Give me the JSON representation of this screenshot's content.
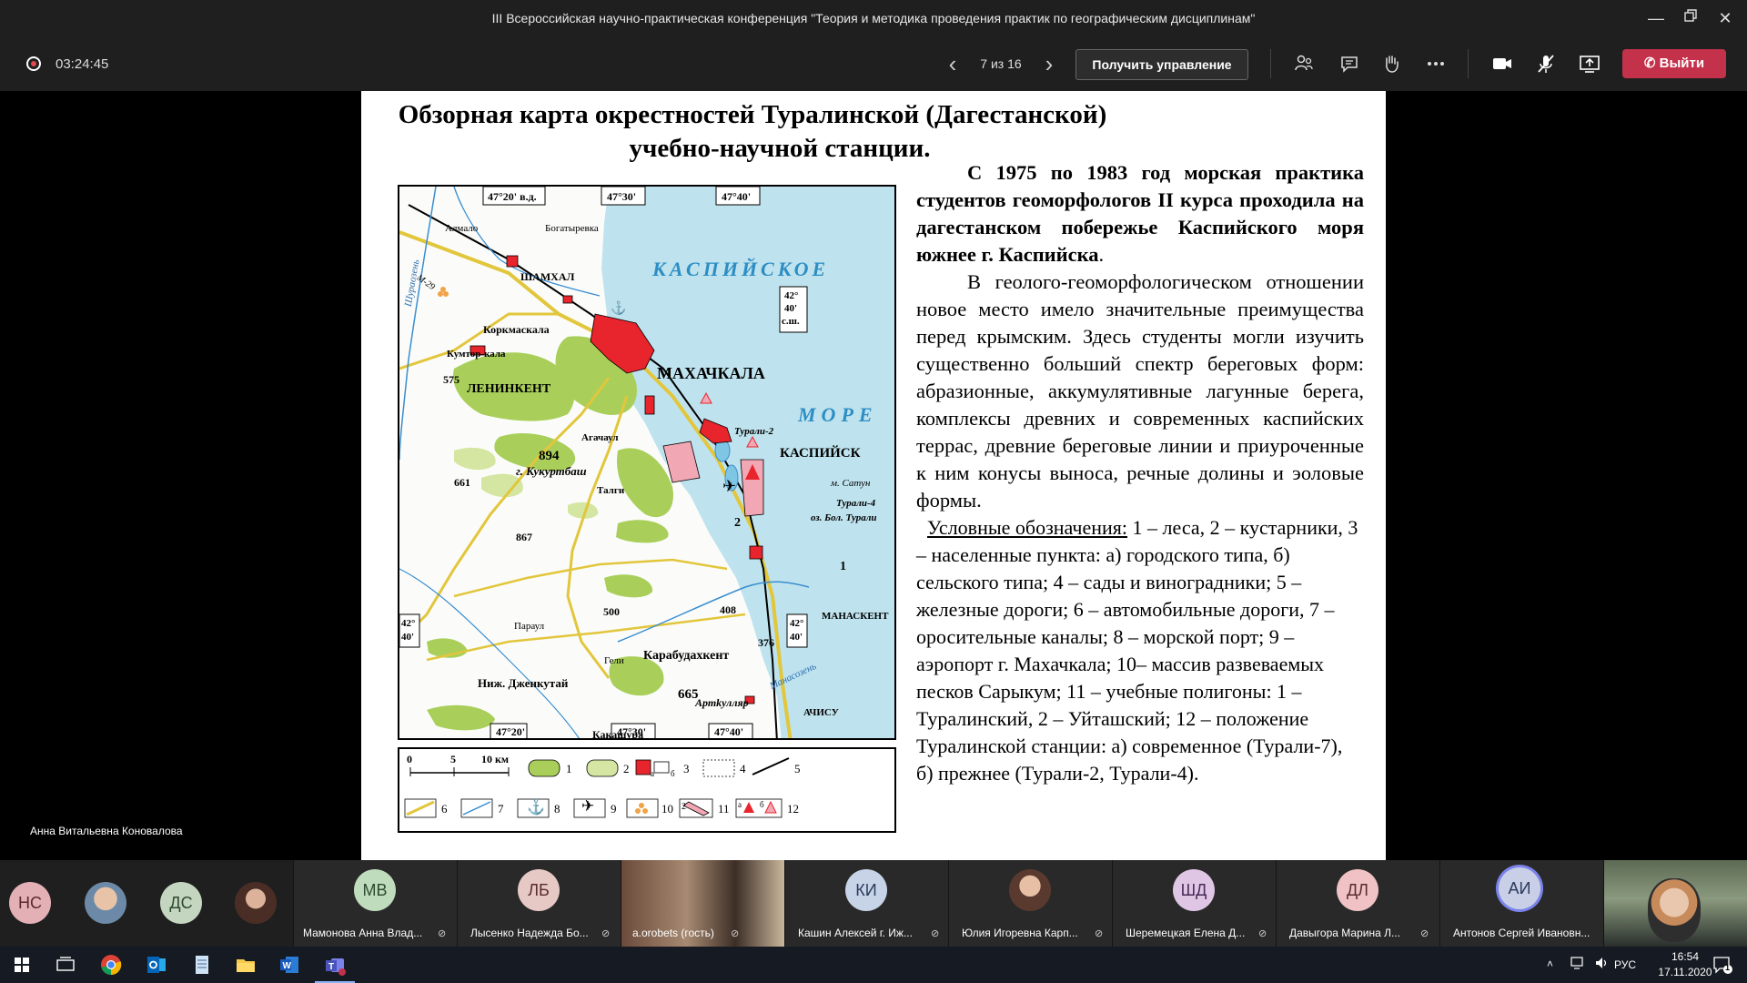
{
  "window": {
    "title": "III Всероссийская научно-практическая конференция \"Теория и методика проведения практик по географическим дисциплинам\""
  },
  "toolbar": {
    "recording_time": "03:24:45",
    "page_indicator": "7 из 16",
    "take_control_label": "Получить управление",
    "leave_label": "Выйти",
    "icons": [
      "prev-slide-icon",
      "next-slide-icon",
      "participants-icon",
      "chat-icon",
      "raise-hand-icon",
      "more-options-icon",
      "camera-icon",
      "mic-muted-icon",
      "share-screen-icon",
      "hang-up-icon"
    ],
    "leave_color": "#c4314b"
  },
  "slide": {
    "title_line1": "Обзорная карта окрестностей Туралинской (Дагестанской)",
    "title_line2": "учебно-научной станции.",
    "para1": "С 1975 по 1983 год морская практика студентов геоморфологов II курса проходила на дагестанском побережье Каспийского моря южнее г. Каспийска",
    "para1_end": ".",
    "para2": "В геолого-геоморфологическом отношении новое место имело значительные преимущества перед крымским. Здесь студенты могли изучить существенно больший спектр береговых форм: абразионные, аккумулятивные лагунные берега, комплексы древних и современных каспийских террас, древние береговые линии и приуроченные к ним конусы выноса, речные долины и эоловые формы.",
    "legend_heading": "Условные обозначения:",
    "legend_text": " 1 – леса, 2 – кустарники, 3 – населенные пункта: а) городского типа, б) сельского типа;  4 – сады и виноградники;  5 – железные дороги;  6 – автомобильные дороги,  7  – оросительные каналы;  8 – морской порт; 9 – аэропорт г. Махачкала;  10– массив развеваемых песков Сарыкум;   11 – учебные полигоны:  1 – Туралинский,    2 – Уйташский;  12 – положение Туралинской станции: а) современное (Турали-7), б) прежнее (Турали-2, Турали-4)."
  },
  "map": {
    "sea_name_1": "КАСПИЙСКОЕ",
    "sea_name_2": "МОРЕ",
    "top_coords": [
      "47°20' в.д.",
      "47°30'",
      "47°40'"
    ],
    "bottom_coords": [
      "47°20'",
      "47°30'",
      "47°40'"
    ],
    "lat_right_top": [
      "42°",
      "40'",
      "с.ш."
    ],
    "lat_right_bottom": [
      "42°",
      "40'"
    ],
    "lat_left_bottom": [
      "42°",
      "40'"
    ],
    "cities": {
      "makhachkala": "МАХАЧКАЛА",
      "kaspiysk": "КАСПИЙСК",
      "leninkent": "ЛЕНИНКЕНТ",
      "shamkhal": "ШАМХАЛ",
      "korkmaskala": "Коркмаскала",
      "kumtorkala": "Кумтор-кала",
      "almalo": "Алмало",
      "bogatyrevka": "Богатыревка",
      "agachaul": "Агачаул",
      "talgi": "Талги",
      "karabudakhkent": "Карабудахкент",
      "manaskent": "МАНАСКЕНТ",
      "achisu": "АЧИСУ",
      "nizh_dzhenkutai": "Ниж. Дженкутай",
      "kakashura": "Какашура",
      "artkullyar": "Артkулляр",
      "gelli": "Гели",
      "paraul": "Параул",
      "turali2": "Турали-2",
      "turali4": "Турали-4",
      "m_satun": "м. Сатун",
      "oz_bol_turali": "оз. Бол. Турали",
      "kukurtbash": "г. Кукуртбаш",
      "shura_ozen": "Шураозень",
      "manas_ozen": "Манасозень",
      "m29": "М-29"
    },
    "heights": [
      "575",
      "894",
      "661",
      "867",
      "500",
      "408",
      "376",
      "665"
    ],
    "polygons": [
      "1",
      "2"
    ],
    "scale_labels": [
      "0",
      "5",
      "10 км"
    ],
    "legend_numbers": [
      "1",
      "2",
      "3",
      "4",
      "5",
      "6",
      "7",
      "8",
      "9",
      "10",
      "11",
      "12"
    ],
    "legend_sublabels": [
      "а",
      "б",
      "а",
      "б",
      "2"
    ],
    "colors": {
      "sea": "#bfe3ee",
      "forest": "#a9cf5a",
      "shrub": "#d4e6a1",
      "city": "#e8242c",
      "polygon": "#f2a7b5",
      "road": "#e2c63c",
      "river": "#3a8ed0"
    }
  },
  "presenter_name": "Анна Витальевна Коновалова",
  "participants": [
    {
      "initials": "НС",
      "color": "#e3b0b6"
    },
    {
      "initials": "",
      "kind": "photo"
    },
    {
      "initials": "ДС",
      "color": "#c4d6c0"
    },
    {
      "initials": "",
      "kind": "photo"
    },
    {
      "initials": "МВ",
      "color": "#bfdcbc",
      "name": "Мамонова Анна Влад..."
    },
    {
      "initials": "ЛБ",
      "color": "#e6c9c5",
      "name": "Лысенко Надежда Бо..."
    },
    {
      "initials": "",
      "kind": "video",
      "name": "a.orobets (гость)"
    },
    {
      "initials": "КИ",
      "color": "#c7d3e7",
      "name": "Кашин Алексей г. Иж..."
    },
    {
      "initials": "",
      "kind": "photo",
      "name": "Юлия Игоревна Карп..."
    },
    {
      "initials": "ШД",
      "color": "#dfc6e5",
      "name": "Шеремецкая Елена Д..."
    },
    {
      "initials": "ДЛ",
      "color": "#f0c2c5",
      "name": "Давыгора Марина Л..."
    },
    {
      "initials": "АИ",
      "color": "#c8cfe6",
      "name": "Антонов Сергей Ивановн..."
    },
    {
      "initials": "",
      "kind": "self-video"
    }
  ],
  "taskbar": {
    "apps": [
      "windows-start-icon",
      "task-view-icon",
      "chrome-icon",
      "outlook-icon",
      "notepad-icon",
      "file-explorer-icon",
      "word-icon",
      "teams-icon"
    ],
    "language": "РУС",
    "time": "16:54",
    "date": "17.11.2020",
    "notification_count": "1"
  }
}
